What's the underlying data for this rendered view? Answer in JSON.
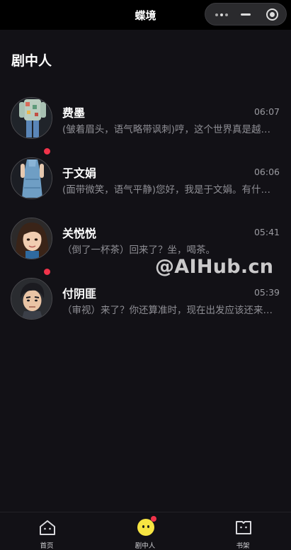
{
  "app": {
    "title": "蝶境"
  },
  "page": {
    "title": "剧中人"
  },
  "chats": [
    {
      "name": "费墨",
      "time": "06:07",
      "preview": "(皱着眉头，语气略带讽刺)哼，这个世界真是越来越离谱了",
      "unread": false
    },
    {
      "name": "于文娟",
      "time": "06:06",
      "preview": "(面带微笑，语气平静)您好，我是于文娟。有什么可以帮您",
      "unread": true
    },
    {
      "name": "关悦悦",
      "time": "05:41",
      "preview": "（倒了一杯茶）回来了？坐，喝茶。",
      "unread": false
    },
    {
      "name": "付阴匪",
      "time": "05:39",
      "preview": "（审视）来了？你还算准时，现在出发应该还来得及",
      "unread": true
    }
  ],
  "watermark": "@AIHub.cn",
  "tabs": [
    {
      "label": "首页",
      "icon": "home-icon"
    },
    {
      "label": "剧中人",
      "icon": "character-face-icon",
      "badge": true
    },
    {
      "label": "书架",
      "icon": "bookshelf-icon"
    }
  ],
  "colors": {
    "background": "#121116",
    "unread": "#f0334a",
    "active_tab_icon": "#f6e442"
  }
}
